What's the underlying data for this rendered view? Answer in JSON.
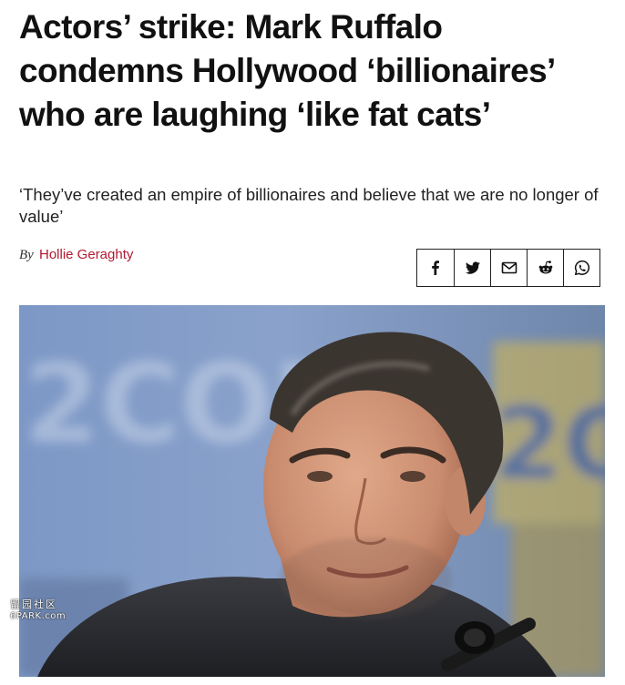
{
  "article": {
    "headline": "Actors’ strike: Mark Ruffalo condemns Hollywood ‘billionaires’ who are laughing ‘like fat cats’",
    "standfirst": "‘They’ve created an empire of billionaires and believe that we are no longer of value’",
    "byline_prefix": "By",
    "author": "Hollie Geraghty"
  },
  "share_icons": [
    "facebook-icon",
    "twitter-icon",
    "email-icon",
    "reddit-icon",
    "whatsapp-icon"
  ],
  "watermark": {
    "chinese": "留园社区",
    "latin": "6PARK.com"
  },
  "colors": {
    "author_link": "#b01830",
    "text": "#111111"
  }
}
